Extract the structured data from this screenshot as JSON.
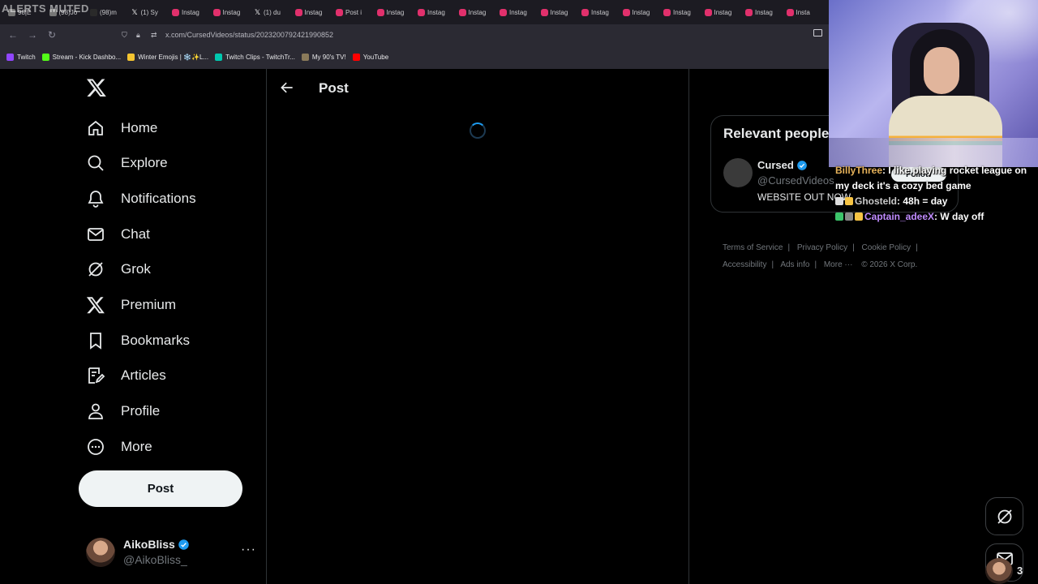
{
  "overlay": {
    "alerts_muted": "ALERTS MUTED"
  },
  "browser": {
    "tabs": [
      {
        "label": "98|E",
        "icon": "generic"
      },
      {
        "label": "(98)Jo",
        "icon": "generic"
      },
      {
        "label": "(98)m",
        "icon": "tiktok"
      },
      {
        "label": "(1) Sy",
        "icon": "x"
      },
      {
        "label": "Instag",
        "icon": "instagram"
      },
      {
        "label": "Instag",
        "icon": "instagram"
      },
      {
        "label": "(1) du",
        "icon": "x"
      },
      {
        "label": "Instag",
        "icon": "instagram"
      },
      {
        "label": "Post i",
        "icon": "instagram"
      },
      {
        "label": "Instag",
        "icon": "instagram"
      },
      {
        "label": "Instag",
        "icon": "instagram"
      },
      {
        "label": "Instag",
        "icon": "instagram"
      },
      {
        "label": "Instag",
        "icon": "instagram"
      },
      {
        "label": "Instag",
        "icon": "instagram"
      },
      {
        "label": "Instag",
        "icon": "instagram"
      },
      {
        "label": "Instag",
        "icon": "instagram"
      },
      {
        "label": "Instag",
        "icon": "instagram"
      },
      {
        "label": "Instag",
        "icon": "instagram"
      },
      {
        "label": "Instag",
        "icon": "instagram"
      },
      {
        "label": "Insta",
        "icon": "instagram"
      }
    ],
    "url": "x.com/CursedVideos/status/2023200792421990852",
    "bookmarks": [
      {
        "label": "Twitch",
        "color": "#9146ff"
      },
      {
        "label": "Stream - Kick Dashbo...",
        "color": "#53fc18"
      },
      {
        "label": "Winter Emojis | ❄️✨L...",
        "color": "#f4c430"
      },
      {
        "label": "Twitch Clips - TwitchTr...",
        "color": "#00c8af"
      },
      {
        "label": "My 90's TV!",
        "color": "#8a7a5a"
      },
      {
        "label": "YouTube",
        "color": "#ff0000"
      }
    ]
  },
  "sidebar": {
    "nav": [
      {
        "label": "Home",
        "icon": "home-icon"
      },
      {
        "label": "Explore",
        "icon": "search-icon"
      },
      {
        "label": "Notifications",
        "icon": "bell-icon"
      },
      {
        "label": "Chat",
        "icon": "envelope-icon"
      },
      {
        "label": "Grok",
        "icon": "grok-icon"
      },
      {
        "label": "Premium",
        "icon": "x-logo-icon"
      },
      {
        "label": "Bookmarks",
        "icon": "bookmark-icon"
      },
      {
        "label": "Articles",
        "icon": "article-icon"
      },
      {
        "label": "Profile",
        "icon": "person-icon"
      },
      {
        "label": "More",
        "icon": "more-circle-icon"
      }
    ],
    "post_button": "Post",
    "account": {
      "name": "AikoBliss",
      "handle": "@AikoBliss_"
    }
  },
  "main": {
    "title": "Post"
  },
  "right": {
    "relevant_title": "Relevant people",
    "person": {
      "name": "Cursed",
      "handle": "@CursedVideos",
      "bio": "WEBSITE OUT NOW",
      "follow": "Follow"
    },
    "footer": [
      "Terms of Service",
      "Privacy Policy",
      "Cookie Policy",
      "Accessibility",
      "Ads info",
      "More ···",
      "© 2026 X Corp."
    ]
  },
  "chat": {
    "messages": [
      {
        "user": "BillyThree",
        "text": ": I like playing rocket league on my deck it's a cozy bed game"
      },
      {
        "user": "Ghosteld",
        "text": ": 48h = day"
      },
      {
        "user": "Captain_adeeX",
        "text": ": W day off"
      }
    ]
  },
  "floating": {
    "dm_count": "3"
  },
  "colors": {
    "accent": "#1d9bf0",
    "background": "#000000",
    "text": "#e7e9ea",
    "muted": "#71767b",
    "border": "#2f3336"
  }
}
